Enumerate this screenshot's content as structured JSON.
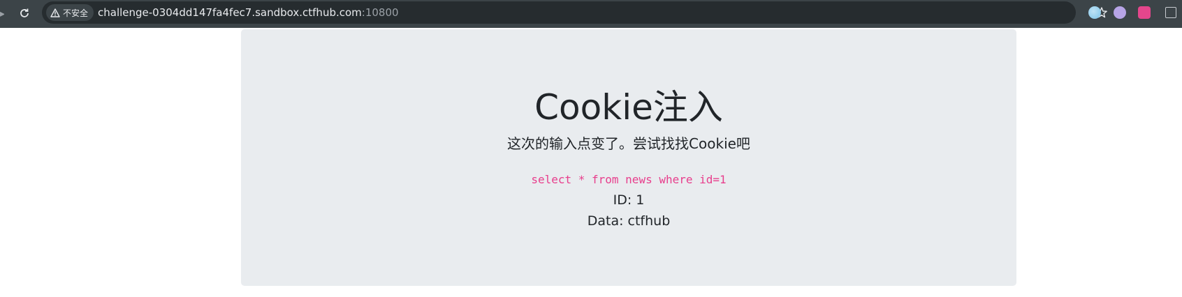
{
  "browser": {
    "security_label": "不安全",
    "url_host": "challenge-0304dd147fa4fec7.sandbox.ctfhub.com",
    "url_port": ":10800"
  },
  "page": {
    "title": "Cookie注入",
    "lead": "这次的输入点变了。尝试找找Cookie吧",
    "query": "select * from news where id=1",
    "id_line": "ID: 1",
    "data_line": "Data: ctfhub"
  },
  "colors": {
    "toolbar_bg": "#3c4448",
    "jumbotron_bg": "#e9ecef",
    "code_pink": "#e83e8c",
    "text_dark": "#212529"
  },
  "icons": [
    "back-arrow-icon",
    "reload-icon",
    "warning-icon",
    "bookmark-star-icon",
    "extension-globe-icon",
    "extension-purple-icon",
    "extension-translate-icon",
    "tab-page-icon"
  ]
}
